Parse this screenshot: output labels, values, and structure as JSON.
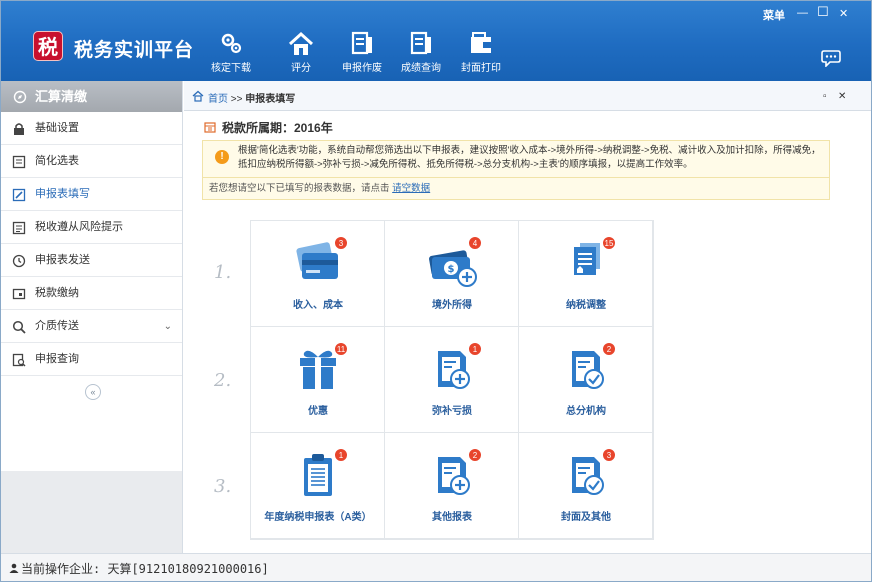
{
  "app": {
    "title": "税务实训平台",
    "logo_char": "税",
    "menu_label": "菜单",
    "minimize": "—",
    "maximize": "☐",
    "close": "✕"
  },
  "toolbar": [
    {
      "label": "核定下载",
      "icon": "gears-icon"
    },
    {
      "label": "评分",
      "icon": "home-icon"
    },
    {
      "label": "申报作废",
      "icon": "ledger-icon"
    },
    {
      "label": "成绩查询",
      "icon": "ledger-icon"
    },
    {
      "label": "封面打印",
      "icon": "wallet-icon"
    }
  ],
  "sidebar": {
    "header": "汇算清缴",
    "items": [
      {
        "label": "基础设置",
        "icon": "lock-icon"
      },
      {
        "label": "简化选表",
        "icon": "list-icon"
      },
      {
        "label": "申报表填写",
        "icon": "edit-icon",
        "active": true
      },
      {
        "label": "税收遵从风险提示",
        "icon": "doc-icon"
      },
      {
        "label": "申报表发送",
        "icon": "clock-icon"
      },
      {
        "label": "税款缴纳",
        "icon": "payment-icon"
      },
      {
        "label": "介质传送",
        "icon": "search-icon",
        "has_caret": true
      },
      {
        "label": "申报查询",
        "icon": "query-icon"
      }
    ],
    "collapse_glyph": "«"
  },
  "tabbar": {
    "home": "首页",
    "separator": " >> ",
    "current": "申报表填写",
    "restore": "▫",
    "close": "✕"
  },
  "main": {
    "period": "税款所属期：2016年",
    "notice": "根据'简化选表'功能，系统自动帮您筛选出以下申报表，建议按照'收入成本->境外所得->纳税调整->免税、减计收入及加计扣除，所得减免，抵扣应纳税所得额->弥补亏损->减免所得税、抵免所得税->总分支机构->主表'的顺序填报，以提高工作效率。",
    "clear_text": "若您想请空以下已填写的报表数据，请点击",
    "clear_link": "请空数据",
    "step_numbers": [
      "1.",
      "2.",
      "3."
    ],
    "cards": [
      {
        "label": "收入、成本",
        "badge": "3",
        "icon": "card-icon"
      },
      {
        "label": "境外所得",
        "badge": "4",
        "icon": "money-add-icon"
      },
      {
        "label": "纳税调整",
        "badge": "15",
        "icon": "files-icon"
      },
      {
        "label": "优惠",
        "badge": "11",
        "icon": "gift-icon"
      },
      {
        "label": "弥补亏损",
        "badge": "1",
        "icon": "form-add-icon"
      },
      {
        "label": "总分机构",
        "badge": "2",
        "icon": "form-check-icon"
      },
      {
        "label": "年度纳税申报表（A类）",
        "badge": "1",
        "icon": "clipboard-icon"
      },
      {
        "label": "其他报表",
        "badge": "2",
        "icon": "form-add-icon"
      },
      {
        "label": "封面及其他",
        "badge": "3",
        "icon": "form-check-icon"
      }
    ]
  },
  "status": {
    "text": "当前操作企业: 天算[91210180921000016]"
  },
  "colors": {
    "header_blue": "#1f6cc1",
    "accent_blue": "#2b6cb8",
    "badge_red": "#e8452c",
    "icon_blue": "#2e7bc9"
  }
}
